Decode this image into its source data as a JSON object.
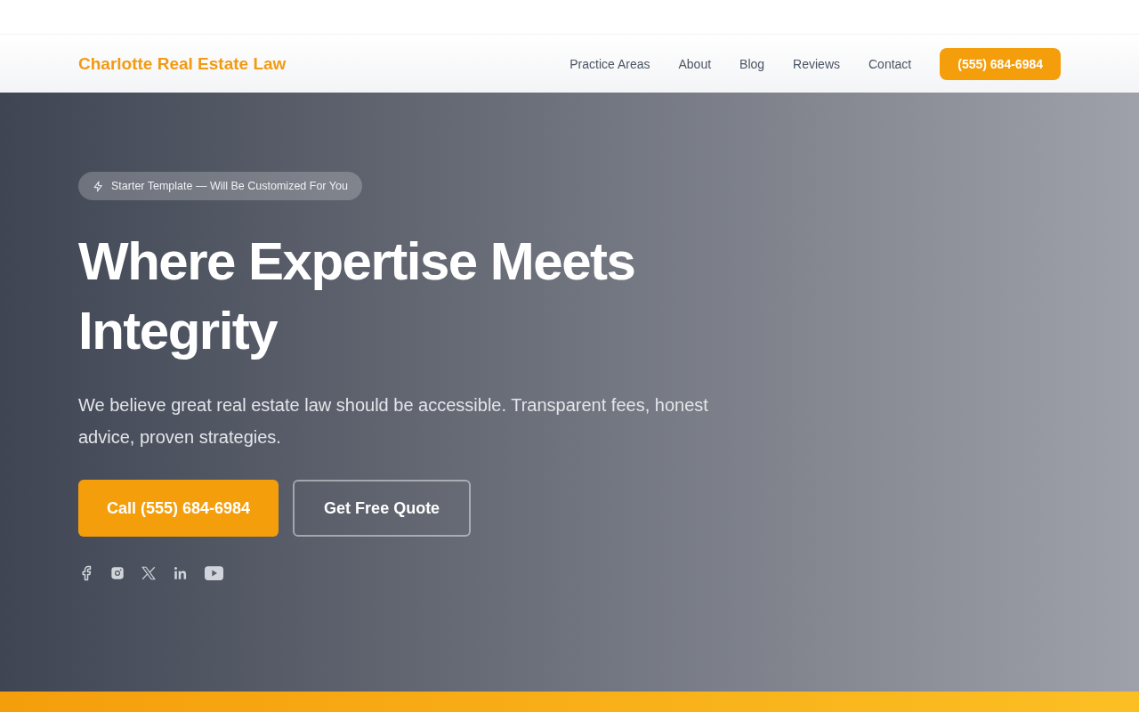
{
  "header": {
    "logo": "Charlotte Real Estate Law",
    "nav": [
      "Practice Areas",
      "About",
      "Blog",
      "Reviews",
      "Contact"
    ],
    "phone_button": "(555) 684-6984"
  },
  "hero": {
    "badge": "Starter Template — Will Be Customized For You",
    "title": "Where Expertise Meets Integrity",
    "subtitle": "We believe great real estate law should be accessible. Transparent fees, honest advice, proven strategies.",
    "buttons": [
      {
        "label": "Call (555) 684-6984",
        "kind": "primary"
      },
      {
        "label": "Get Free Quote",
        "kind": "outline"
      }
    ]
  }
}
